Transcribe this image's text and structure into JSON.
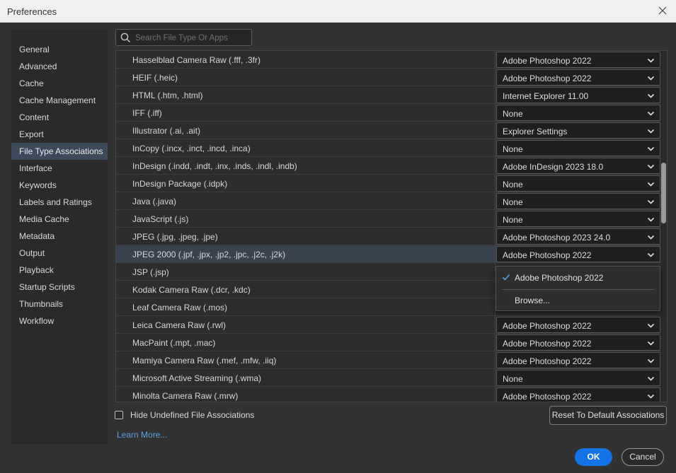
{
  "window": {
    "title": "Preferences"
  },
  "sidebar": {
    "items": [
      {
        "label": "General"
      },
      {
        "label": "Advanced"
      },
      {
        "label": "Cache"
      },
      {
        "label": "Cache Management"
      },
      {
        "label": "Content"
      },
      {
        "label": "Export"
      },
      {
        "label": "File Type Associations",
        "selected": true
      },
      {
        "label": "Interface"
      },
      {
        "label": "Keywords"
      },
      {
        "label": "Labels and Ratings"
      },
      {
        "label": "Media Cache"
      },
      {
        "label": "Metadata"
      },
      {
        "label": "Output"
      },
      {
        "label": "Playback"
      },
      {
        "label": "Startup Scripts"
      },
      {
        "label": "Thumbnails"
      },
      {
        "label": "Workflow"
      }
    ]
  },
  "search": {
    "placeholder": "Search File Type Or Apps",
    "value": "",
    "icon": "search-icon"
  },
  "table": {
    "rows": [
      {
        "name": "Hasselblad Camera Raw (.fff, .3fr)",
        "app": "Adobe Photoshop 2022"
      },
      {
        "name": "HEIF (.heic)",
        "app": "Adobe Photoshop 2022"
      },
      {
        "name": "HTML (.htm, .html)",
        "app": "Internet Explorer 11.00"
      },
      {
        "name": "IFF (.iff)",
        "app": "None"
      },
      {
        "name": "Illustrator (.ai, .ait)",
        "app": "Explorer Settings"
      },
      {
        "name": "InCopy (.incx, .inct, .incd, .inca)",
        "app": "None"
      },
      {
        "name": "InDesign (.indd, .indt, .inx, .inds, .indl, .indb)",
        "app": "Adobe InDesign 2023 18.0"
      },
      {
        "name": "InDesign Package (.idpk)",
        "app": "None"
      },
      {
        "name": "Java (.java)",
        "app": "None"
      },
      {
        "name": "JavaScript (.js)",
        "app": "None"
      },
      {
        "name": "JPEG (.jpg, .jpeg, .jpe)",
        "app": "Adobe Photoshop 2023 24.0"
      },
      {
        "name": "JPEG 2000 (.jpf, .jpx, .jp2, .jpc, .j2c, .j2k)",
        "app": "Adobe Photoshop 2022",
        "highlighted": true
      },
      {
        "name": "JSP (.jsp)",
        "app": ""
      },
      {
        "name": "Kodak Camera Raw (.dcr, .kdc)",
        "app": ""
      },
      {
        "name": "Leaf Camera Raw (.mos)",
        "app": ""
      },
      {
        "name": "Leica Camera Raw (.rwl)",
        "app": "Adobe Photoshop 2022"
      },
      {
        "name": "MacPaint (.mpt, .mac)",
        "app": "Adobe Photoshop 2022"
      },
      {
        "name": "Mamiya Camera Raw (.mef, .mfw, .iiq)",
        "app": "Adobe Photoshop 2022"
      },
      {
        "name": "Microsoft Active Streaming (.wma)",
        "app": "None"
      },
      {
        "name": "Minolta Camera Raw (.mrw)",
        "app": "Adobe Photoshop 2022"
      }
    ]
  },
  "dropdown": {
    "items": [
      {
        "label": "Adobe Photoshop 2022",
        "checked": true
      },
      {
        "label": "Browse..."
      }
    ]
  },
  "footer": {
    "hide_undefined_label": "Hide Undefined File Associations",
    "hide_undefined_checked": false,
    "reset_label": "Reset To Default Associations",
    "learn_more": "Learn More...",
    "ok": "OK",
    "cancel": "Cancel"
  },
  "colors": {
    "accent": "#1473e6",
    "link": "#5aa0e8",
    "selection": "#3d4a5c",
    "row_highlight": "#394350"
  }
}
